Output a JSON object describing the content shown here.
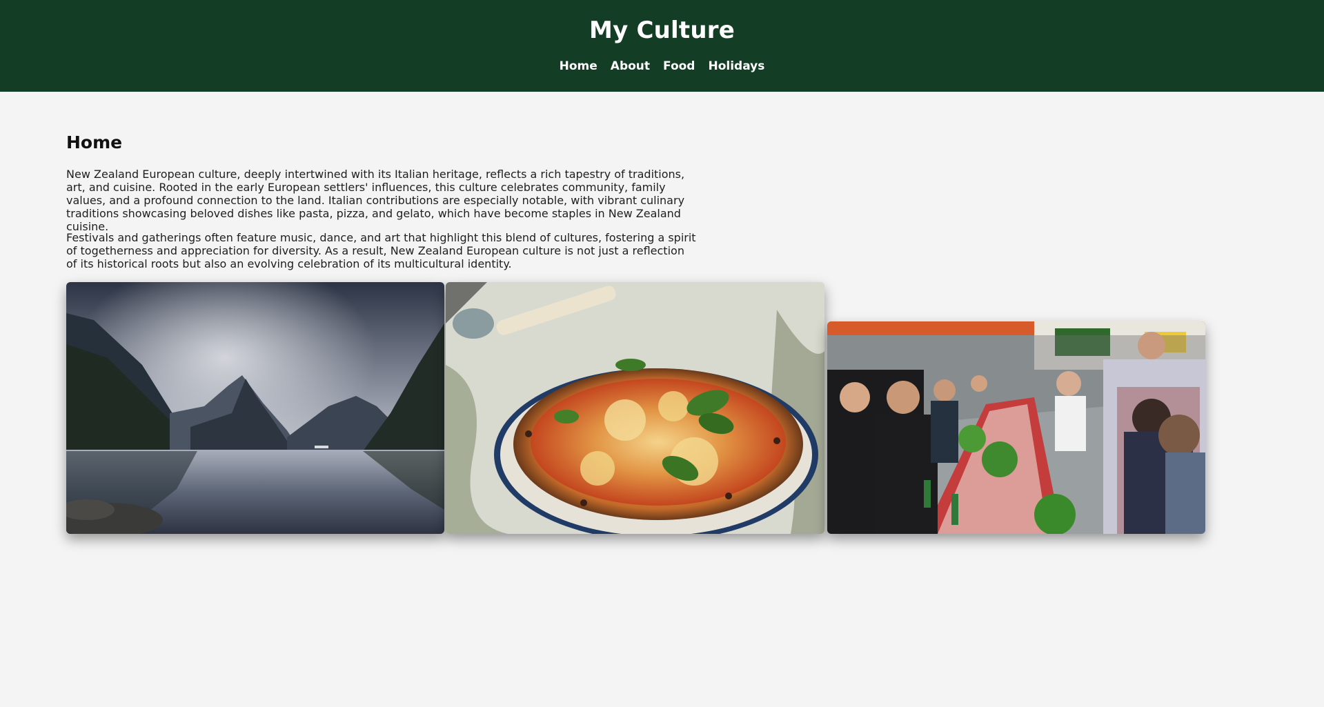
{
  "header": {
    "title": "My Culture",
    "nav": [
      {
        "label": "Home"
      },
      {
        "label": "About"
      },
      {
        "label": "Food"
      },
      {
        "label": "Holidays"
      }
    ]
  },
  "main": {
    "heading": "Home",
    "paragraphs": [
      "New Zealand European culture, deeply intertwined with its Italian heritage, reflects a rich tapestry of traditions, art, and cuisine. Rooted in the early European settlers' influences, this culture celebrates community, family values, and a profound connection to the land. Italian contributions are especially notable, with vibrant culinary traditions showcasing beloved dishes like pasta, pizza, and gelato, which have become staples in New Zealand cuisine.",
      "Festivals and gatherings often feature music, dance, and art that highlight this blend of cultures, fostering a spirit of togetherness and appreciation for diversity. As a result, New Zealand European culture is not just a reflection of its historical roots but also an evolving celebration of its multicultural identity."
    ]
  },
  "colors": {
    "header_background": "#133d25",
    "page_background": "#f4f4f4"
  }
}
